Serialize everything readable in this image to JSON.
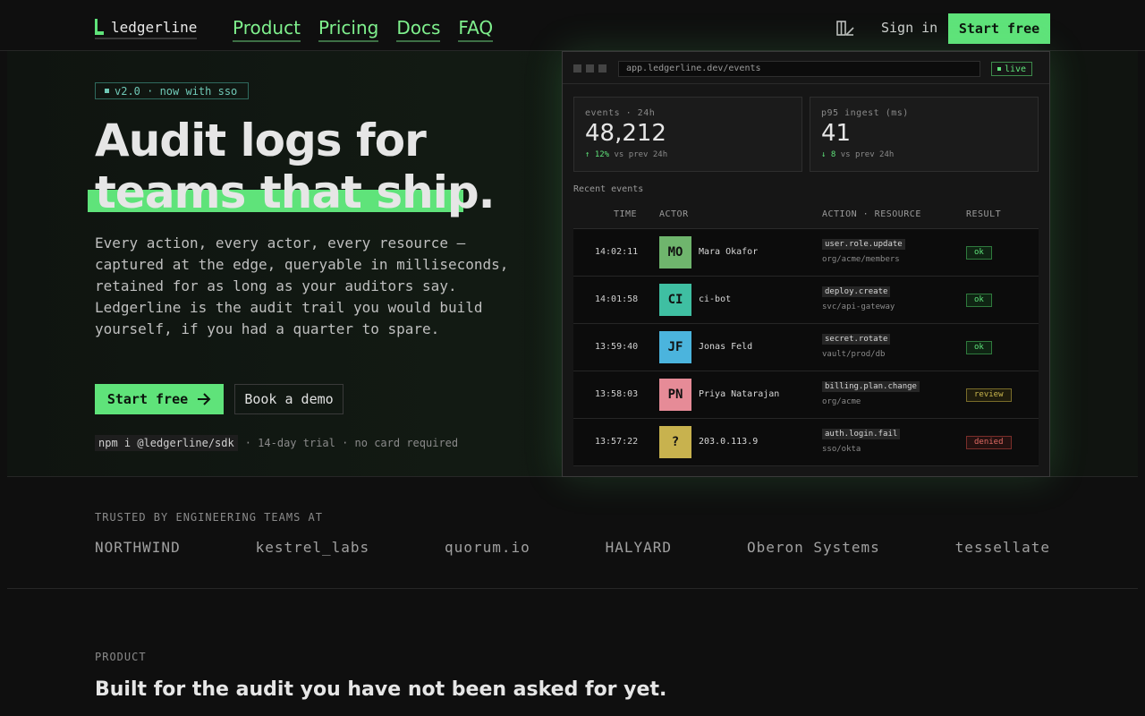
{
  "nav": {
    "logo": "ledgerline",
    "links": [
      "Product",
      "Pricing",
      "Docs",
      "FAQ"
    ],
    "sign_in": "Sign in",
    "start_free": "Start free",
    "theme_icon": "theme-toggle-icon"
  },
  "hero": {
    "badge": "v2.0 · now with sso",
    "title_line1": "Audit logs for",
    "title_line2": "teams that ship.",
    "lead": "Every action, every actor, every resource — captured at the edge, queryable in milliseconds, retained for as long as your auditors say. Ledgerline is the audit trail you would build yourself, if you had a quarter to spare.",
    "cta_primary": "Start free",
    "cta_primary_icon": "arrow-right-icon",
    "cta_secondary": "Book a demo",
    "install_cmd": "npm i @ledgerline/sdk",
    "install_note": "· 14-day trial · no card required"
  },
  "app": {
    "url": "app.ledgerline.dev/events",
    "live": "live",
    "stats": [
      {
        "label": "events · 24h",
        "value": "48,212",
        "delta": "↑ 12%",
        "delta_note": "vs prev 24h"
      },
      {
        "label": "p95 ingest (ms)",
        "value": "41",
        "delta": "↓ 8",
        "delta_note": "vs prev 24h"
      }
    ],
    "recent_title": "Recent events",
    "columns": [
      "TIME",
      "ACTOR",
      "ACTION · RESOURCE",
      "RESULT"
    ],
    "rows": [
      {
        "time": "14:02:11",
        "initials": "MO",
        "avatar_color": "#6fb56d",
        "actor": "Mara Okafor",
        "action": "user.role.update",
        "resource": "org/acme/members",
        "result": "ok",
        "result_kind": "ok"
      },
      {
        "time": "14:01:58",
        "initials": "CI",
        "avatar_color": "#3fbfa2",
        "actor": "ci-bot",
        "action": "deploy.create",
        "resource": "svc/api-gateway",
        "result": "ok",
        "result_kind": "ok"
      },
      {
        "time": "13:59:40",
        "initials": "JF",
        "avatar_color": "#4bb4dd",
        "actor": "Jonas Feld",
        "action": "secret.rotate",
        "resource": "vault/prod/db",
        "result": "ok",
        "result_kind": "ok"
      },
      {
        "time": "13:58:03",
        "initials": "PN",
        "avatar_color": "#e68b97",
        "actor": "Priya Natarajan",
        "action": "billing.plan.change",
        "resource": "org/acme",
        "result": "review",
        "result_kind": "review"
      },
      {
        "time": "13:57:22",
        "initials": "?",
        "avatar_color": "#c8b24e",
        "actor": "203.0.113.9",
        "action": "auth.login.fail",
        "resource": "sso/okta",
        "result": "denied",
        "result_kind": "denied"
      }
    ]
  },
  "trusted": {
    "title": "TRUSTED BY ENGINEERING TEAMS AT",
    "logos": [
      "NORTHWIND",
      "kestrel_labs",
      "quorum.io",
      "HALYARD",
      "Oberon Systems",
      "tessellate"
    ]
  },
  "product": {
    "label": "PRODUCT",
    "title": "Built for the audit you have not been asked for yet."
  }
}
